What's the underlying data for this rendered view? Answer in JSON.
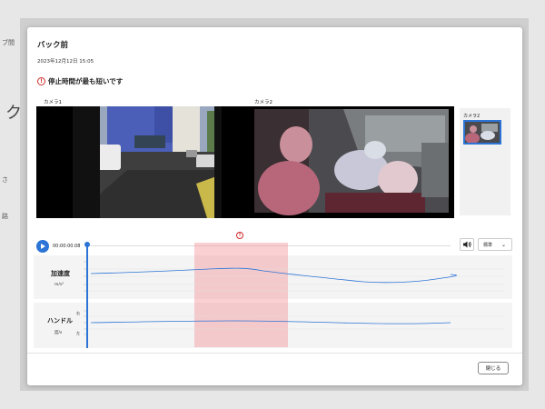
{
  "background": {
    "fragments": [
      "ブ間",
      "ク",
      "さ",
      "路"
    ]
  },
  "modal": {
    "title": "バック前",
    "datetime": "2023年12月12日 15:05",
    "alert_text": "停止時間が最も短いです",
    "alert_color": "#d12a2a"
  },
  "cameras": {
    "camera1_label": "カメラ1",
    "camera2_label": "カメラ2",
    "thumbnail_label": "カメラ2"
  },
  "player": {
    "current_time": "00:00:00.08",
    "speed_value": "標準",
    "accent": "#2c74d6"
  },
  "charts": {
    "acceleration": {
      "label": "加速度",
      "unit": "m/s²"
    },
    "steering": {
      "label": "ハンドル",
      "unit": "度/s",
      "top_tick": "右",
      "bottom_tick": "左"
    }
  },
  "footer": {
    "close_label": "閉じる"
  }
}
